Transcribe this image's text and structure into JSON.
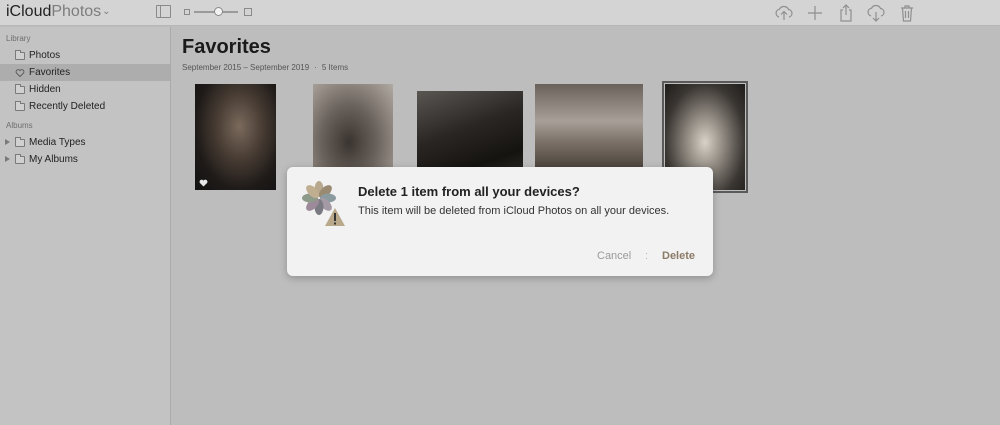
{
  "app": {
    "brand": "iCloud",
    "product": "Photos",
    "brand_chevron": "⌄"
  },
  "toolbar": {
    "icons": [
      "sidebar-toggle-icon",
      "zoom-slider",
      "upload-icon",
      "add-icon",
      "share-icon",
      "download-icon",
      "trash-icon"
    ],
    "zoom_level": 0.55
  },
  "sidebar": {
    "library_header": "Library",
    "library_items": [
      {
        "label": "Photos",
        "icon": "folder-icon",
        "selected": false
      },
      {
        "label": "Favorites",
        "icon": "heart-icon",
        "selected": true
      },
      {
        "label": "Hidden",
        "icon": "folder-icon",
        "selected": false
      },
      {
        "label": "Recently Deleted",
        "icon": "folder-icon",
        "selected": false
      }
    ],
    "albums_header": "Albums",
    "album_items": [
      {
        "label": "Media Types",
        "icon": "folder-icon",
        "expandable": true
      },
      {
        "label": "My Albums",
        "icon": "folder-icon",
        "expandable": true
      }
    ]
  },
  "main": {
    "title": "Favorites",
    "date_range": "September 2015 – September 2019",
    "separator": "·",
    "item_count": "5 Items",
    "thumbnails": [
      {
        "favorite": true,
        "selected": false
      },
      {
        "favorite": false,
        "selected": false
      },
      {
        "favorite": false,
        "selected": false
      },
      {
        "favorite": false,
        "selected": false
      },
      {
        "favorite": false,
        "selected": true
      }
    ]
  },
  "dialog": {
    "title": "Delete 1 item from all your devices?",
    "message": "This item will be deleted from iCloud Photos on all your devices.",
    "cancel_label": "Cancel",
    "separator": ":",
    "delete_label": "Delete",
    "icon": "photos-warning-icon"
  },
  "colors": {
    "overlay_gray": "#bdbdbd",
    "sidebar_bg": "#c3c3c3",
    "dialog_bg": "#f2f2f2",
    "delete_text": "#8a7a66",
    "cancel_text": "#9a9a9a"
  }
}
